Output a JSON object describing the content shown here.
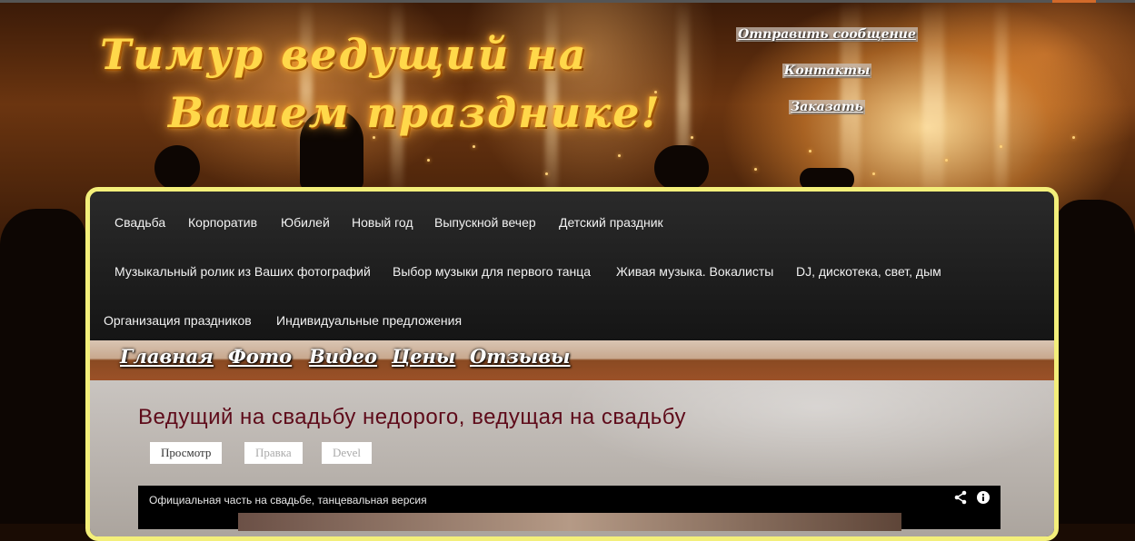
{
  "header": {
    "logo_line1": "Тимур ведущий на",
    "logo_line2": "Вашем празднике!",
    "links": [
      {
        "label": "Отправить сообщение"
      },
      {
        "label": "Контакты"
      },
      {
        "label": "Заказать"
      }
    ]
  },
  "main_nav": {
    "items": [
      {
        "label": "Свадьба"
      },
      {
        "label": "Корпоратив"
      },
      {
        "label": "Юбилей"
      },
      {
        "label": "Новый год"
      },
      {
        "label": "Выпускной вечер"
      },
      {
        "label": "Детский праздник"
      },
      {
        "label": "Музыкальный ролик из Ваших фотографий"
      },
      {
        "label": "Выбор музыки для первого танца"
      },
      {
        "label": "Живая музыка. Вокалисты"
      },
      {
        "label": "DJ, дискотека, свет, дым"
      },
      {
        "label": "Организация праздников"
      },
      {
        "label": "Индивидуальные предложения"
      }
    ]
  },
  "secondary_nav": {
    "items": [
      {
        "label": "Главная"
      },
      {
        "label": "Фото"
      },
      {
        "label": "Видео"
      },
      {
        "label": "Цены"
      },
      {
        "label": "Отзывы"
      }
    ]
  },
  "page": {
    "title": "Ведущий на свадьбу недорого, ведущая на свадьбу",
    "tabs": [
      {
        "label": "Просмотр",
        "active": true
      },
      {
        "label": "Правка",
        "active": false
      },
      {
        "label": "Devel",
        "active": false
      }
    ]
  },
  "video": {
    "title": "Официальная часть на свадьбе, танцевальная версия",
    "share_icon": "share-icon",
    "info_icon": "info-icon"
  },
  "colors": {
    "frame_border": "#f3ef7a",
    "title_color": "#5e0b1a",
    "logo_color": "#ffd84a"
  }
}
